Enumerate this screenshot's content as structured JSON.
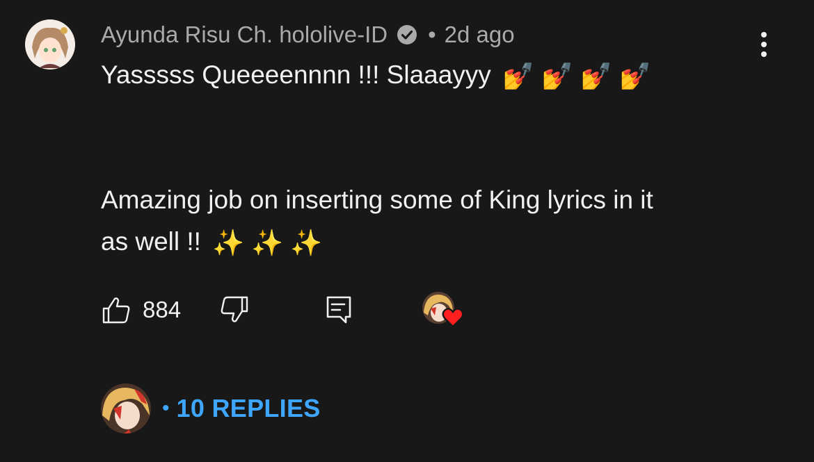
{
  "comment": {
    "author": "Ayunda Risu Ch. hololive-ID",
    "separator": "•",
    "time": "2d ago",
    "lines": [
      "Yasssss Queeeennnn !!! Slaaayyy",
      "Amazing job on inserting some of King lyrics in it",
      "as well !!"
    ],
    "line1_emojis": [
      "💅",
      "💅",
      "💅",
      "💅"
    ],
    "line4_emojis": [
      "✨",
      "✨",
      "✨"
    ],
    "likes": "884"
  },
  "replies": {
    "bullet": "•",
    "label": "10 REPLIES"
  },
  "colors": {
    "background": "#181818",
    "text": "#f1f1f1",
    "muted": "#aaaaaa",
    "link": "#3ea6ff",
    "heart": "#ff1f1f"
  },
  "icons": {
    "verified": "verified-check-icon",
    "more": "more-vertical-icon",
    "like": "thumbs-up-icon",
    "dislike": "thumbs-down-icon",
    "reply": "reply-comment-icon",
    "heart": "heart-icon"
  }
}
